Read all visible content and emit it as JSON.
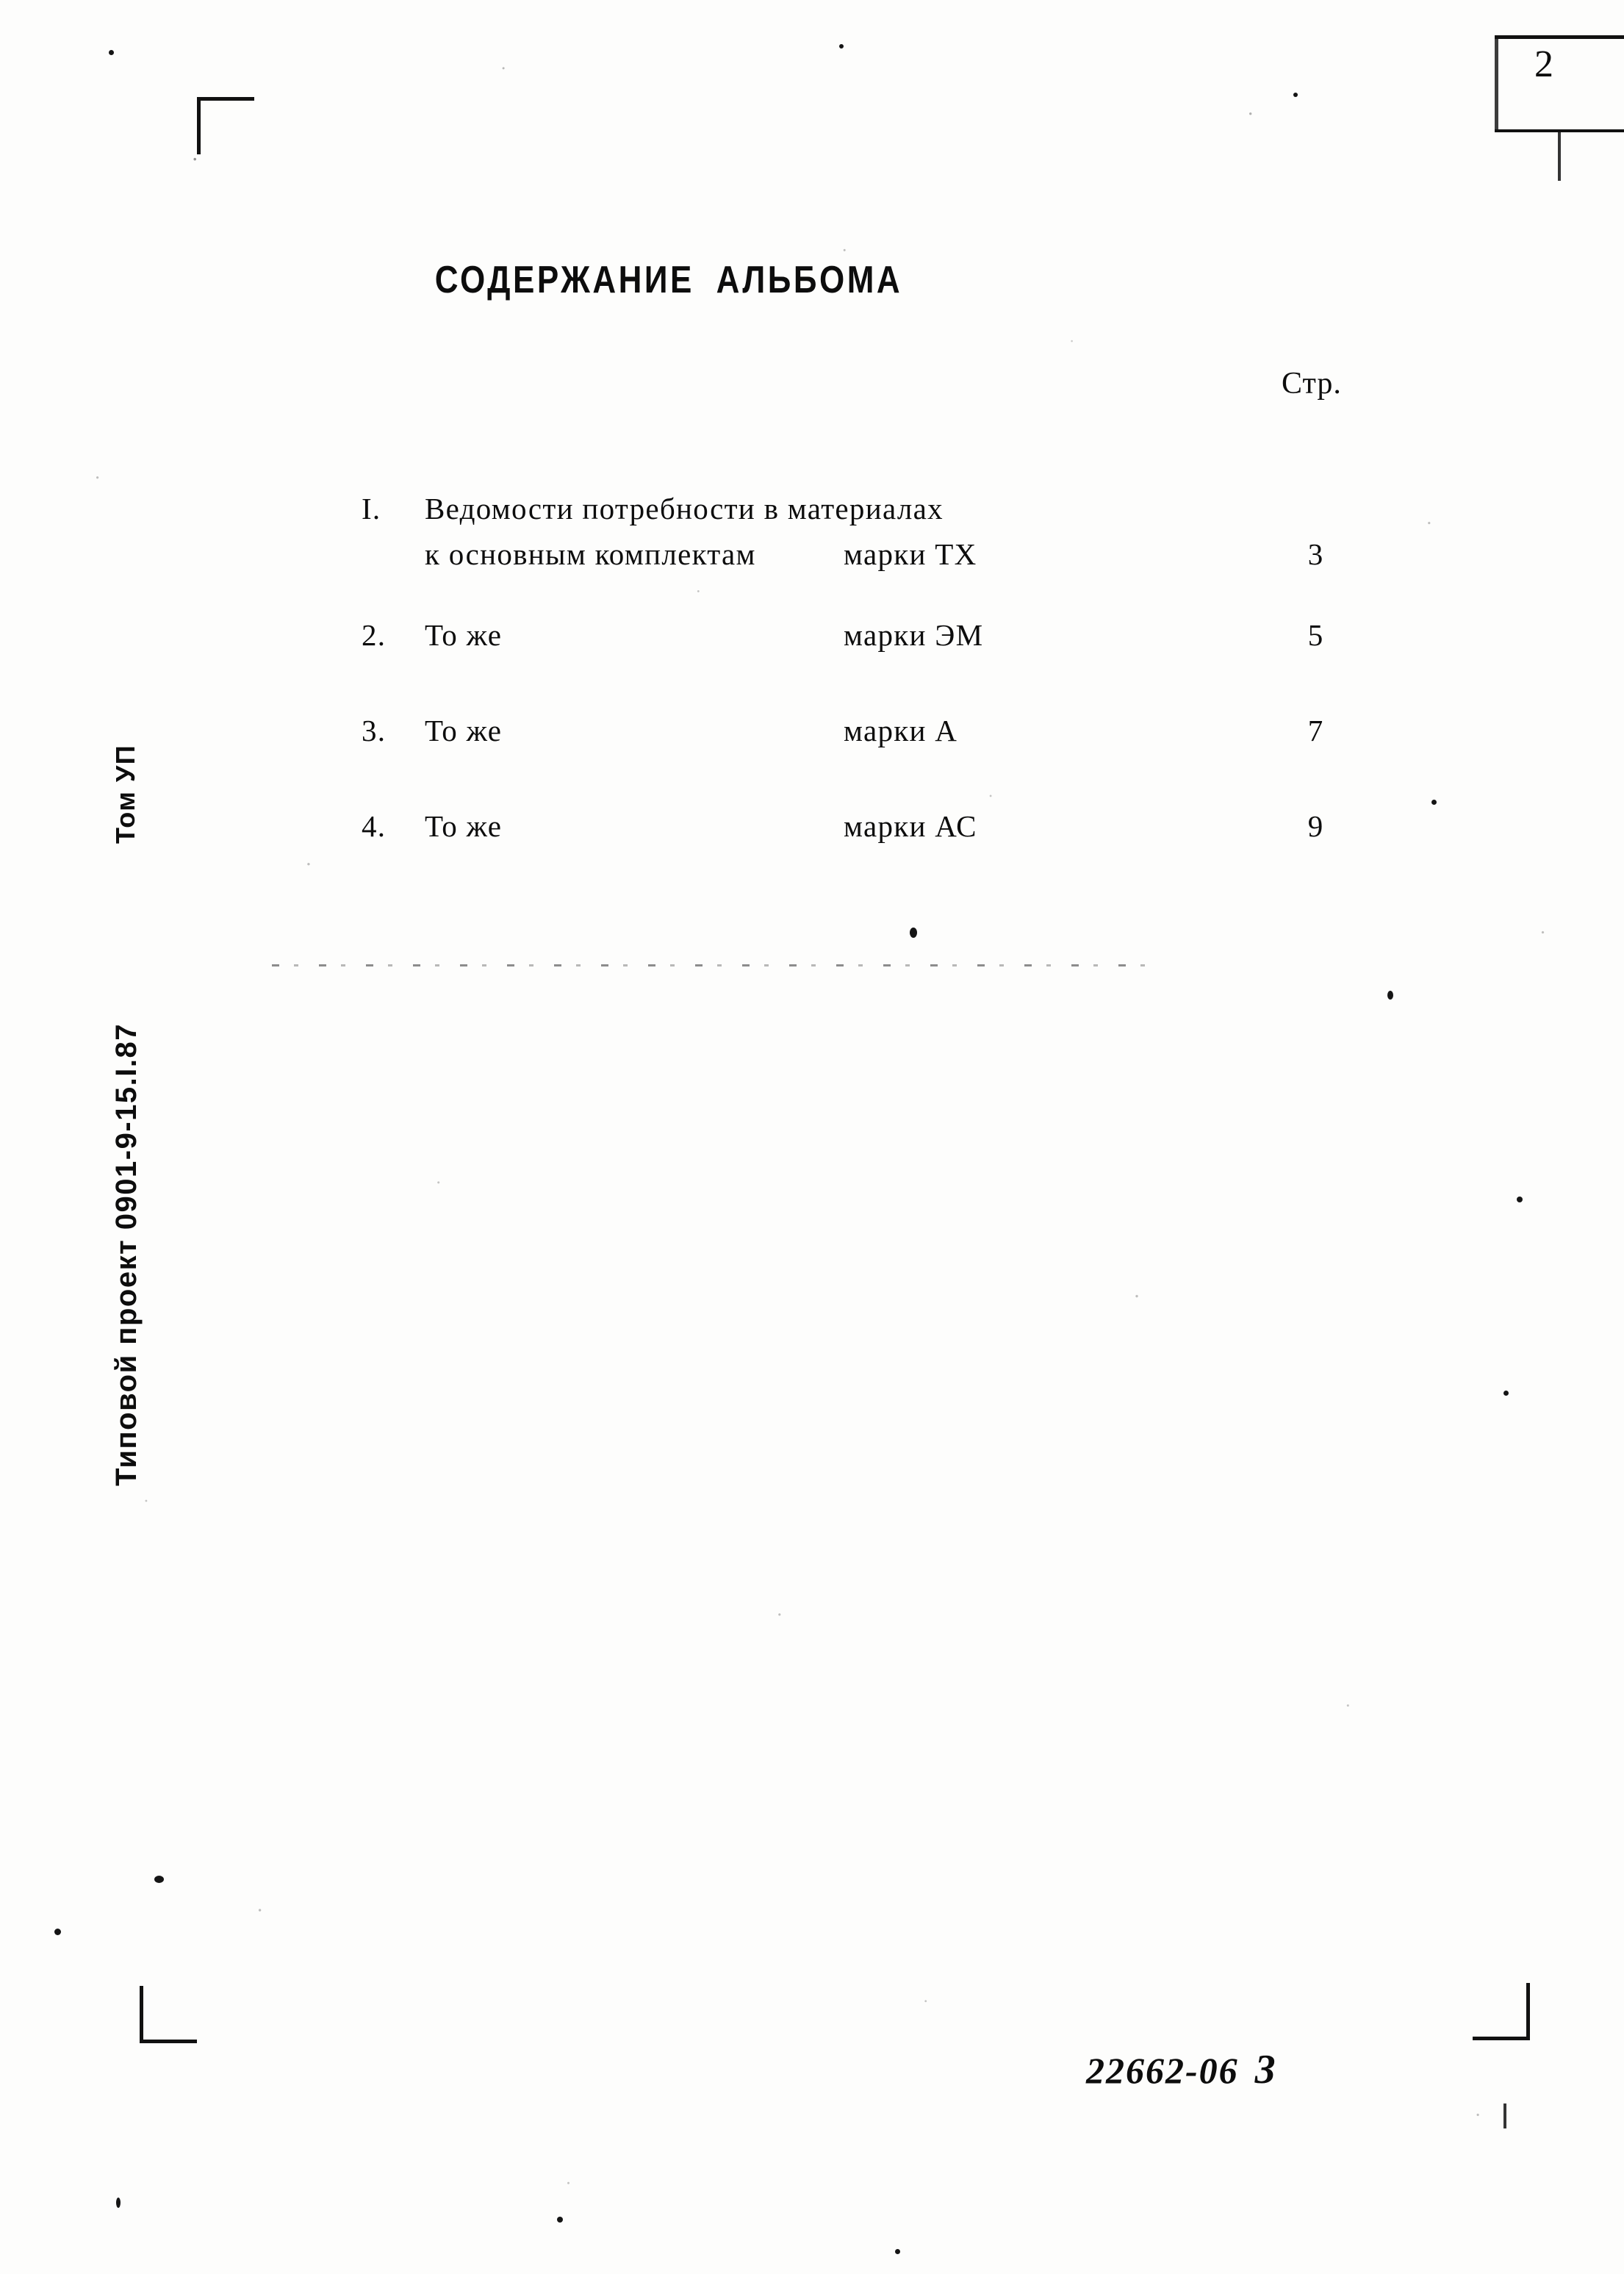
{
  "document": {
    "title": "СОДЕРЖАНИЕ АЛЬБОМА",
    "page_number_box": "2",
    "column_header": "Стр."
  },
  "toc": {
    "entries": [
      {
        "number": "I.",
        "label_line1": "Ведомости потребности в материалах",
        "label_line2": "к основным комплектам",
        "mark": "марки ТХ",
        "page": "3"
      },
      {
        "number": "2.",
        "label_line1": "То же",
        "label_line2": "",
        "mark": "марки ЭМ",
        "page": "5"
      },
      {
        "number": "3.",
        "label_line1": "То же",
        "label_line2": "",
        "mark": "марки А",
        "page": "7"
      },
      {
        "number": "4.",
        "label_line1": "То же",
        "label_line2": "",
        "mark": "марки АС",
        "page": "9"
      }
    ]
  },
  "margin": {
    "project_imprint": "Типовой проект 0901-9-15.I.87",
    "volume_imprint": "Том УП"
  },
  "stamp": {
    "code": "22662-06",
    "copy_number": "3"
  }
}
